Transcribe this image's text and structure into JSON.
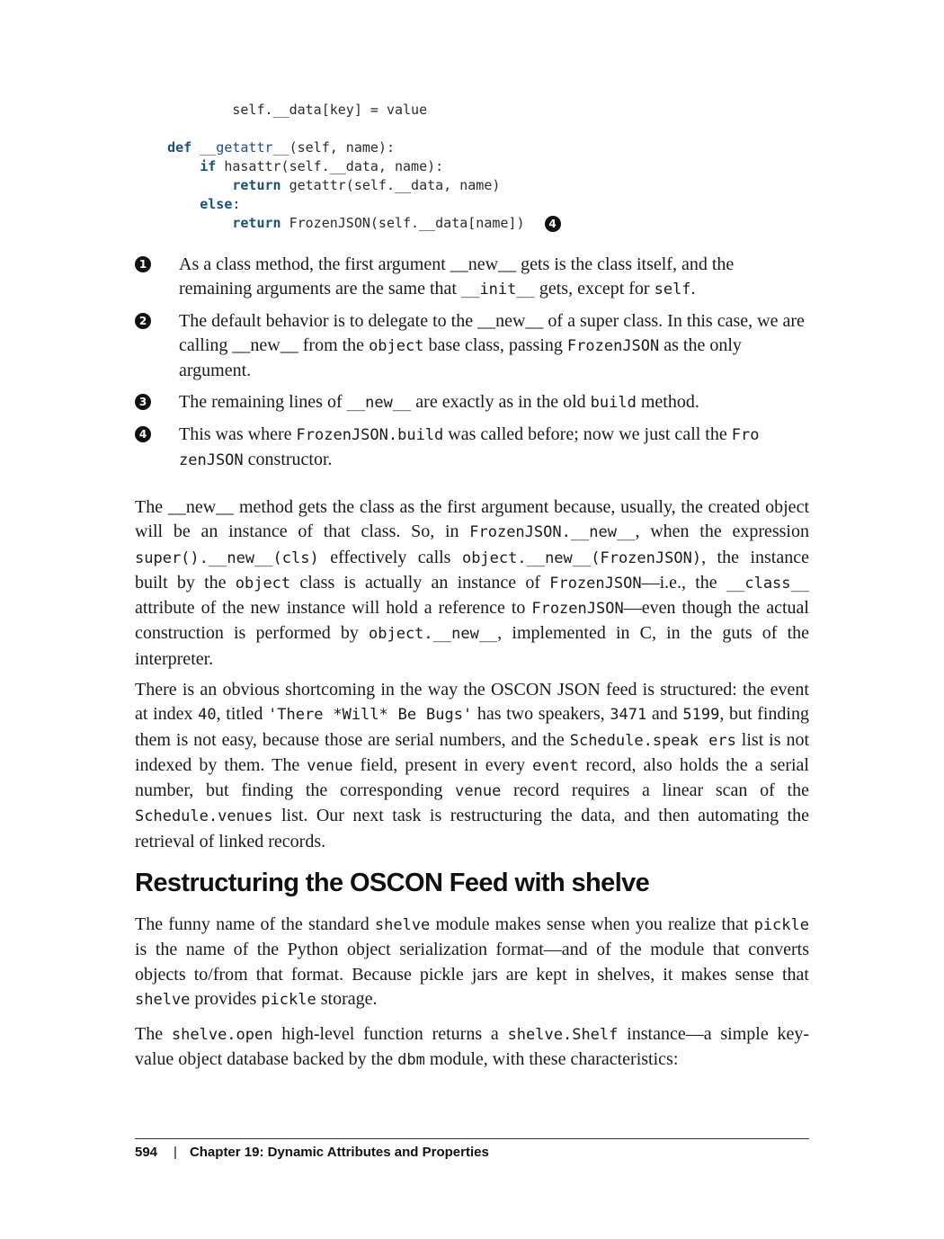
{
  "code": {
    "l1": {
      "indent": "            ",
      "text": "self.__data[key] = value"
    },
    "l3": {
      "kw": "def",
      "fn": "__getattr__",
      "rest": "(self, name):"
    },
    "l4": {
      "kw": "if",
      "rest": " hasattr(self.__data, name):"
    },
    "l5": {
      "kw": "return",
      "rest": " getattr(self.__data, name)"
    },
    "l6": {
      "kw": "else",
      "rest": ":"
    },
    "l7": {
      "kw": "return",
      "rest": " FrozenJSON(self.__data[name])"
    },
    "callout": "4"
  },
  "notes": [
    {
      "num": "1",
      "parts": [
        "As a class method, the first argument __new__ gets is the class itself, and the remaining arguments are the same that ",
        "__init__",
        " gets, except for ",
        "self",
        "."
      ]
    },
    {
      "num": "2",
      "parts": [
        "The default behavior is to delegate to the __new__ of a super class. In this case, we are calling __new__ from the ",
        "object",
        " base class, passing ",
        "FrozenJSON",
        " as the only argument."
      ]
    },
    {
      "num": "3",
      "parts": [
        "The remaining lines of ",
        "__new__",
        " are exactly as in the old ",
        "build",
        " method."
      ]
    },
    {
      "num": "4",
      "parts": [
        "This was where ",
        "FrozenJSON.build",
        " was called before; now we just call the ",
        "Fro zenJSON",
        " constructor."
      ]
    }
  ],
  "para1": [
    "The __new__ method gets the class as the first argument because, usually, the created object will be an instance of that class. So, in ",
    "FrozenJSON.__new__",
    ", when the expression ",
    "super().__new__(cls)",
    " effectively calls ",
    "object.__new__(FrozenJSON)",
    ", the instance built by the ",
    "object",
    " class is actually an instance of ",
    "FrozenJSON",
    "—i.e., the ",
    "__class__",
    " attribute of the new instance will hold a reference to ",
    "FrozenJSON",
    "—even though the actual construction is performed by ",
    "object.__new__",
    ", implemented in C, in the guts of the interpreter."
  ],
  "para2": [
    "There is an obvious shortcoming in the way the OSCON JSON feed is structured: the event at index ",
    "40",
    ", titled ",
    "'There *Will* Be Bugs'",
    " has two speakers, ",
    "3471",
    " and ",
    "5199",
    ", but finding them is not easy, because those are serial numbers, and the ",
    "Schedule.speak ers",
    " list is not indexed by them. The ",
    "venue",
    " field, present in every ",
    "event",
    " record, also holds the a serial number, but finding the corresponding ",
    "venue",
    " record requires a linear scan of the ",
    "Schedule.venues",
    " list. Our next task is restructuring the data, and then automating the retrieval of linked records."
  ],
  "section_title": "Restructuring the OSCON Feed with shelve",
  "para3": [
    "The funny name of the standard ",
    "shelve",
    " module makes sense when you realize that ",
    "pickle",
    " is the name of the Python object serialization format—and of the module that converts objects to/from that format. Because pickle jars are kept in shelves, it makes sense that ",
    "shelve",
    " provides ",
    "pickle",
    " storage."
  ],
  "para4": [
    "The ",
    "shelve.open",
    " high-level function returns a ",
    "shelve.Shelf",
    " instance—a simple key-value object database backed by the ",
    "dbm",
    " module, with these characteristics:"
  ],
  "footer": {
    "page": "594",
    "sep": "|",
    "chapter": "Chapter 19: Dynamic Attributes and Properties"
  }
}
